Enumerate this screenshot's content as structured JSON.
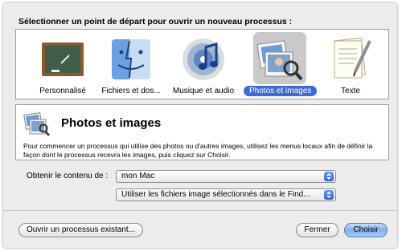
{
  "dialog": {
    "prompt": "Sélectionner un point de départ pour ouvrir un nouveau processus :"
  },
  "starting_points": [
    {
      "label": "Personnalisé",
      "icon": "chalkboard-icon",
      "selected": false
    },
    {
      "label": "Fichiers et dos...",
      "icon": "finder-icon",
      "selected": false
    },
    {
      "label": "Musique et audio",
      "icon": "itunes-icon",
      "selected": false
    },
    {
      "label": "Photos et images",
      "icon": "photos-icon",
      "selected": true
    },
    {
      "label": "Texte",
      "icon": "text-document-icon",
      "selected": false
    }
  ],
  "info": {
    "title": "Photos et images",
    "description": "Pour commencer un processus qui utilise des photos ou d'autres images, utilisez les menus locaux afin de définir la façon dont le processus recevra les images, puis cliquez sur Choisir."
  },
  "source": {
    "label": "Obtenir le contenu de :",
    "value": "mon Mac",
    "use_value": "Utiliser les fichiers image sélectionnés dans le Find..."
  },
  "buttons": {
    "open_existing": "Ouvrir un processus existant...",
    "close": "Fermer",
    "choose": "Choisir"
  },
  "colors": {
    "selection": "#3d6bd4",
    "default_button": "#7fb0ef"
  }
}
